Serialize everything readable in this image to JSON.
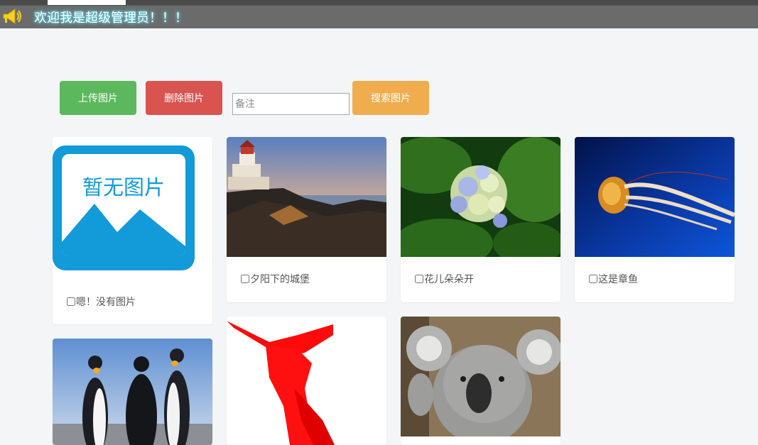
{
  "banner": {
    "text": "欢迎我是超级管理员！！！",
    "icon": "megaphone-icon"
  },
  "toolbar": {
    "upload_label": "上传图片",
    "delete_label": "删除图片",
    "note_placeholder": "备注",
    "search_label": "搜索图片"
  },
  "colors": {
    "upload": "#5cb85c",
    "delete": "#d9534f",
    "search": "#f0ad4e",
    "placeholder_blue": "#129ad9"
  },
  "gallery": {
    "placeholder_text": "暂无图片",
    "items": [
      {
        "caption": "嗯！没有图片"
      },
      {
        "caption": "夕阳下的城堡"
      },
      {
        "caption": "花儿朵朵开"
      },
      {
        "caption": "这是章鱼"
      },
      {
        "caption": ""
      },
      {
        "caption": ""
      },
      {
        "caption": ""
      }
    ]
  }
}
